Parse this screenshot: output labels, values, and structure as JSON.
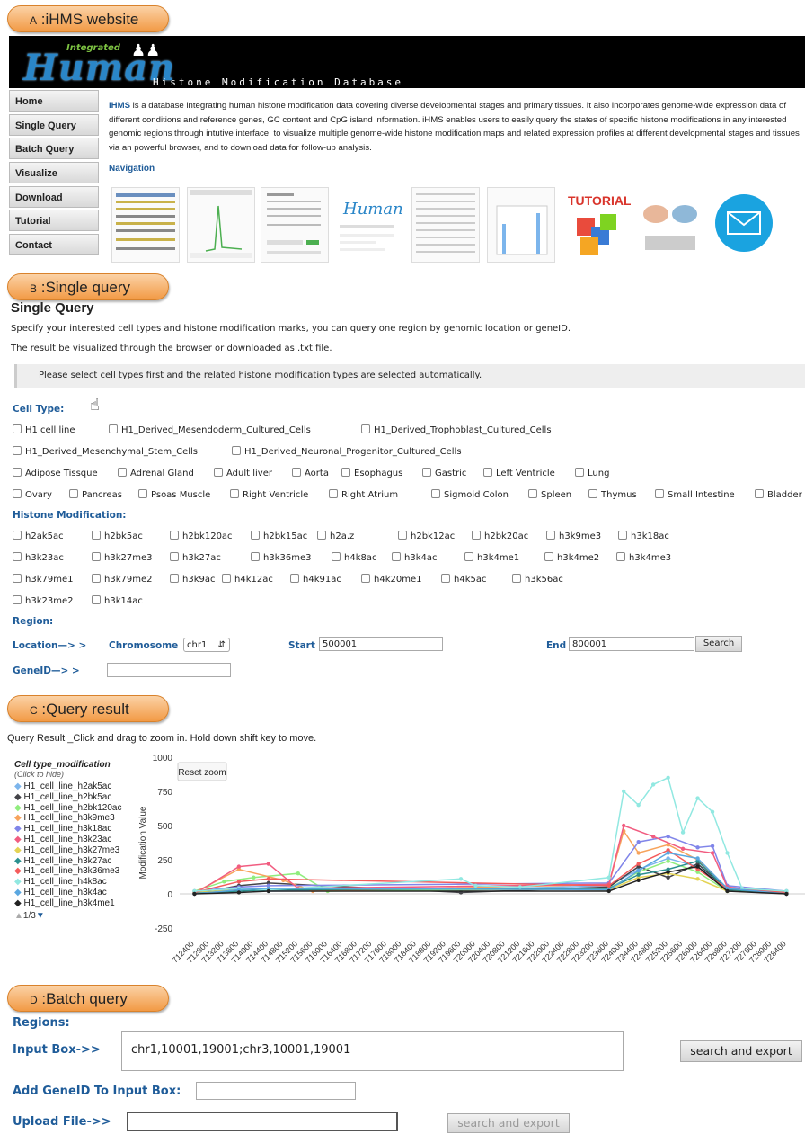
{
  "labels": {
    "a": {
      "letter": "A",
      "text": ":iHMS website"
    },
    "b": {
      "letter": "B",
      "text": ":Single query"
    },
    "c": {
      "letter": "C",
      "text": ":Query result"
    },
    "d": {
      "letter": "D",
      "text": ":Batch query"
    }
  },
  "banner": {
    "logo_small": "Integrated",
    "logo_main": "Human",
    "subtitle": "Histone Modification Database"
  },
  "sidebar": {
    "items": [
      {
        "label": "Home"
      },
      {
        "label": "Single Query"
      },
      {
        "label": "Batch Query"
      },
      {
        "label": "Visualize"
      },
      {
        "label": "Download"
      },
      {
        "label": "Tutorial"
      },
      {
        "label": "Contact"
      }
    ]
  },
  "home": {
    "brand": "iHMS",
    "intro": " is a database integrating human histone modification data covering diverse developmental stages and primary tissues. It also incorporates genome-wide expression data of different conditions and reference genes, GC content and CpG island information. iHMS enables users to easily query the states of specific histone modifications in any interested genomic regions through intutive interface, to visualize multiple genome-wide histone modification maps and related expression profiles at different developmental stages and tissues via an powerful browser, and to download data for follow-up analysis.",
    "navigation": "Navigation",
    "tutorial_thumb": "TUTORIAL"
  },
  "single_query": {
    "title": "Single Query",
    "desc1": "Specify your interested cell types and histone modification marks, you can query one region by genomic location or geneID.",
    "desc2": "The result be visualized through the browser or downloaded as .txt file.",
    "note": "Please select cell types first and the related histone modification types are selected automatically.",
    "cell_type_label": "Cell Type:",
    "cell_types": [
      "H1 cell line",
      "H1_Derived_Mesendoderm_Cultured_Cells",
      "H1_Derived_Trophoblast_Cultured_Cells",
      "H1_Derived_Mesenchymal_Stem_Cells",
      "H1_Derived_Neuronal_Progenitor_Cultured_Cells",
      "Adipose Tissque",
      "Adrenal Gland",
      "Adult liver",
      "Aorta",
      "Esophagus",
      "Gastric",
      "Left Ventricle",
      "Lung",
      "Ovary",
      "Pancreas",
      "Psoas Muscle",
      "Right Ventricle",
      "Right Atrium",
      "Sigmoid Colon",
      "Spleen",
      "Thymus",
      "Small Intestine",
      "Bladder"
    ],
    "histone_label": "Histone Modification:",
    "histone_marks": [
      "h2ak5ac",
      "h2bk5ac",
      "h2bk120ac",
      "h2bk15ac",
      "h2a.z",
      "h2bk12ac",
      "h2bk20ac",
      "h3k9me3",
      "h3k18ac",
      "h3k23ac",
      "h3k27me3",
      "h3k27ac",
      "h3k36me3",
      "h4k8ac",
      "h3k4ac",
      "h3k4me1",
      "h3k4me2",
      "h3k4me3",
      "h3k79me1",
      "h3k79me2",
      "h3k9ac",
      "h4k12ac",
      "h4k91ac",
      "h4k20me1",
      "h4k5ac",
      "h3k56ac",
      "h3k23me2",
      "h3k14ac"
    ],
    "region_label": "Region:",
    "location_label": "Location—> >",
    "chromosome_label": "Chromosome",
    "chromosome_value": "chr1",
    "start_label": "Start",
    "start_value": "500001",
    "end_label": "End",
    "end_value": "800001",
    "search_label": "Search",
    "geneid_label": "GeneID—> >",
    "geneid_value": ""
  },
  "query_result": {
    "title": "Query Result _Click and drag to zoom in. Hold down shift key to move.",
    "legend_title": "Cell type_modification",
    "legend_subtitle": "(Click to hide)",
    "pager": "1/3",
    "reset_zoom": "Reset zoom"
  },
  "chart_data": {
    "type": "line",
    "ylabel": "Modification Value",
    "ylim": [
      -250,
      1000
    ],
    "yticks": [
      1000,
      750,
      500,
      250,
      0,
      -250
    ],
    "x_ticks": [
      712400,
      712800,
      713200,
      713600,
      714000,
      714400,
      714800,
      715200,
      715600,
      716000,
      716400,
      716800,
      717200,
      717600,
      718000,
      718400,
      718800,
      719200,
      719600,
      720000,
      720400,
      720800,
      721200,
      721600,
      722000,
      722400,
      722800,
      723200,
      723600,
      724000,
      724400,
      724800,
      725200,
      725600,
      726000,
      726400,
      726800,
      727200,
      727600,
      728000,
      728400
    ],
    "series": [
      {
        "name": "H1_cell_line_h2ak5ac",
        "color": "#7cb5ec",
        "values": [
          [
            712400,
            10
          ],
          [
            713600,
            40
          ],
          [
            714400,
            20
          ],
          [
            719600,
            30
          ],
          [
            723600,
            60
          ],
          [
            724400,
            180
          ],
          [
            725200,
            260
          ],
          [
            726000,
            200
          ],
          [
            726800,
            40
          ],
          [
            728400,
            10
          ]
        ]
      },
      {
        "name": "H1_cell_line_h2bk5ac",
        "color": "#434348",
        "values": [
          [
            712400,
            0
          ],
          [
            713600,
            60
          ],
          [
            714400,
            80
          ],
          [
            719600,
            10
          ],
          [
            723600,
            50
          ],
          [
            724400,
            200
          ],
          [
            725200,
            120
          ],
          [
            726000,
            220
          ],
          [
            726800,
            30
          ],
          [
            728400,
            0
          ]
        ]
      },
      {
        "name": "H1_cell_line_h2bk120ac",
        "color": "#90ed7d",
        "values": [
          [
            712400,
            20
          ],
          [
            713200,
            90
          ],
          [
            714000,
            120
          ],
          [
            715200,
            150
          ],
          [
            716000,
            20
          ],
          [
            723600,
            40
          ],
          [
            724400,
            160
          ],
          [
            725200,
            240
          ],
          [
            726000,
            160
          ],
          [
            726800,
            20
          ],
          [
            728400,
            20
          ]
        ]
      },
      {
        "name": "H1_cell_line_h3k9me3",
        "color": "#f7a35c",
        "values": [
          [
            712400,
            10
          ],
          [
            713600,
            180
          ],
          [
            714800,
            100
          ],
          [
            715600,
            20
          ],
          [
            723600,
            70
          ],
          [
            724000,
            460
          ],
          [
            724400,
            300
          ],
          [
            725200,
            360
          ],
          [
            726000,
            250
          ],
          [
            726800,
            40
          ],
          [
            728400,
            10
          ]
        ]
      },
      {
        "name": "H1_cell_line_h3k18ac",
        "color": "#8085e9",
        "values": [
          [
            712400,
            20
          ],
          [
            713600,
            50
          ],
          [
            714400,
            60
          ],
          [
            723600,
            80
          ],
          [
            724400,
            380
          ],
          [
            725200,
            420
          ],
          [
            726000,
            340
          ],
          [
            726400,
            350
          ],
          [
            726800,
            60
          ],
          [
            728400,
            20
          ]
        ]
      },
      {
        "name": "H1_cell_line_h3k23ac",
        "color": "#f15c80",
        "values": [
          [
            712400,
            0
          ],
          [
            713600,
            200
          ],
          [
            714400,
            220
          ],
          [
            715200,
            40
          ],
          [
            723600,
            70
          ],
          [
            724000,
            500
          ],
          [
            724800,
            420
          ],
          [
            725600,
            330
          ],
          [
            726400,
            300
          ],
          [
            726800,
            50
          ],
          [
            728400,
            0
          ]
        ]
      },
      {
        "name": "H1_cell_line_h3k27me3",
        "color": "#e4d354",
        "values": [
          [
            712400,
            10
          ],
          [
            713600,
            30
          ],
          [
            714400,
            40
          ],
          [
            723600,
            30
          ],
          [
            724400,
            120
          ],
          [
            725200,
            150
          ],
          [
            726000,
            110
          ],
          [
            726800,
            20
          ],
          [
            728400,
            10
          ]
        ]
      },
      {
        "name": "H1_cell_line_h3k27ac",
        "color": "#2b908f",
        "values": [
          [
            712400,
            5
          ],
          [
            713600,
            20
          ],
          [
            714400,
            30
          ],
          [
            723600,
            40
          ],
          [
            724400,
            140
          ],
          [
            725200,
            180
          ],
          [
            726000,
            240
          ],
          [
            726800,
            30
          ],
          [
            728400,
            5
          ]
        ]
      },
      {
        "name": "H1_cell_line_h3k36me3",
        "color": "#f45b5b",
        "values": [
          [
            712400,
            10
          ],
          [
            713600,
            90
          ],
          [
            714400,
            110
          ],
          [
            723600,
            60
          ],
          [
            724400,
            220
          ],
          [
            725200,
            320
          ],
          [
            726000,
            180
          ],
          [
            726800,
            40
          ],
          [
            728400,
            10
          ]
        ]
      },
      {
        "name": "H1_cell_line_h4k8ac",
        "color": "#91e8e1",
        "values": [
          [
            712400,
            20
          ],
          [
            713600,
            40
          ],
          [
            714400,
            30
          ],
          [
            719600,
            110
          ],
          [
            720000,
            60
          ],
          [
            721200,
            50
          ],
          [
            723600,
            120
          ],
          [
            724000,
            750
          ],
          [
            724400,
            650
          ],
          [
            724800,
            800
          ],
          [
            725200,
            850
          ],
          [
            725600,
            450
          ],
          [
            726000,
            700
          ],
          [
            726400,
            600
          ],
          [
            726800,
            300
          ],
          [
            727200,
            40
          ],
          [
            728400,
            20
          ]
        ]
      },
      {
        "name": "H1_cell_line_h3k4ac",
        "color": "#5aa7e0",
        "values": [
          [
            712400,
            0
          ],
          [
            713600,
            30
          ],
          [
            714400,
            40
          ],
          [
            723600,
            30
          ],
          [
            724400,
            170
          ],
          [
            725200,
            300
          ],
          [
            726000,
            260
          ],
          [
            726800,
            40
          ],
          [
            728400,
            0
          ]
        ]
      },
      {
        "name": "H1_cell_line_h3k4me1",
        "color": "#222222",
        "values": [
          [
            712400,
            0
          ],
          [
            713600,
            10
          ],
          [
            714400,
            20
          ],
          [
            723600,
            20
          ],
          [
            724400,
            100
          ],
          [
            725200,
            160
          ],
          [
            726000,
            200
          ],
          [
            726800,
            20
          ],
          [
            728400,
            0
          ]
        ]
      }
    ]
  },
  "batch_query": {
    "regions_label": "Regions:",
    "input_label": "Input Box->>",
    "input_value": "chr1,10001,19001;chr3,10001,19001",
    "search_export": "search and export",
    "add_gene_label": "Add GeneID To Input Box:",
    "add_gene_value": "",
    "upload_label": "Upload File->>",
    "upload_value": "",
    "search_export_disabled": "search and export"
  }
}
